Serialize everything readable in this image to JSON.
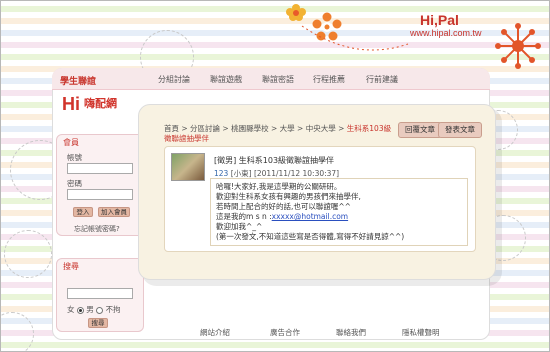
{
  "header": {
    "brand": "Hi,Pal",
    "url": "www.hipal.com.tw"
  },
  "nav": {
    "site_title": "學生聯誼",
    "items": [
      "分組討論",
      "聯誼遊戲",
      "聯誼密語",
      "行程推薦",
      "行前建議"
    ]
  },
  "logo": {
    "hi": "Hi",
    "text": "嗨配網"
  },
  "login": {
    "heading": "會員",
    "account_label": "帳號",
    "password_label": "密碼",
    "login_button": "登入",
    "join_button": "加入會員",
    "forgot": "忘記帳號密碼?"
  },
  "search": {
    "heading": "搜尋",
    "gender_female": "女",
    "gender_male": "男",
    "gender_any": "不拘",
    "search_button": "搜尋"
  },
  "breadcrumb": {
    "path": "首頁 > 分區討論 > 桃園縣學校 > 大學 > 中央大學 >",
    "active": "生科系103級徵聯誼抽學伴"
  },
  "actions": {
    "reply": "回覆文章",
    "new_post": "發表文章"
  },
  "post": {
    "title": "[徵男] 生科系103級徵聯誼抽學伴",
    "meta_number": "123",
    "meta_rest": "[小東] [2011/11/12 10:30:37]",
    "body_lines": [
      "哈囉!大家好,我是這學期的公關研研。",
      "歡迎對生科系女孩有興趣的男孩們來抽學伴,",
      "若時間上配合的好的話,也可以聯誼喔^^",
      "這是我的m s n :"
    ],
    "email": "xxxxx@hotmail.com",
    "body_lines_after": [
      "歡迎加我^_^",
      "(第一次發文,不知道這些寫是否得體,寫得不好請見諒^^)"
    ]
  },
  "footer": {
    "links": [
      "網站介紹",
      "廣告合作",
      "聯絡我們",
      "隱私權聲明"
    ]
  },
  "colors": {
    "brand_red": "#c8342c",
    "popup_bg": "#f8f2e2",
    "button_bg": "#e9cbbf"
  }
}
